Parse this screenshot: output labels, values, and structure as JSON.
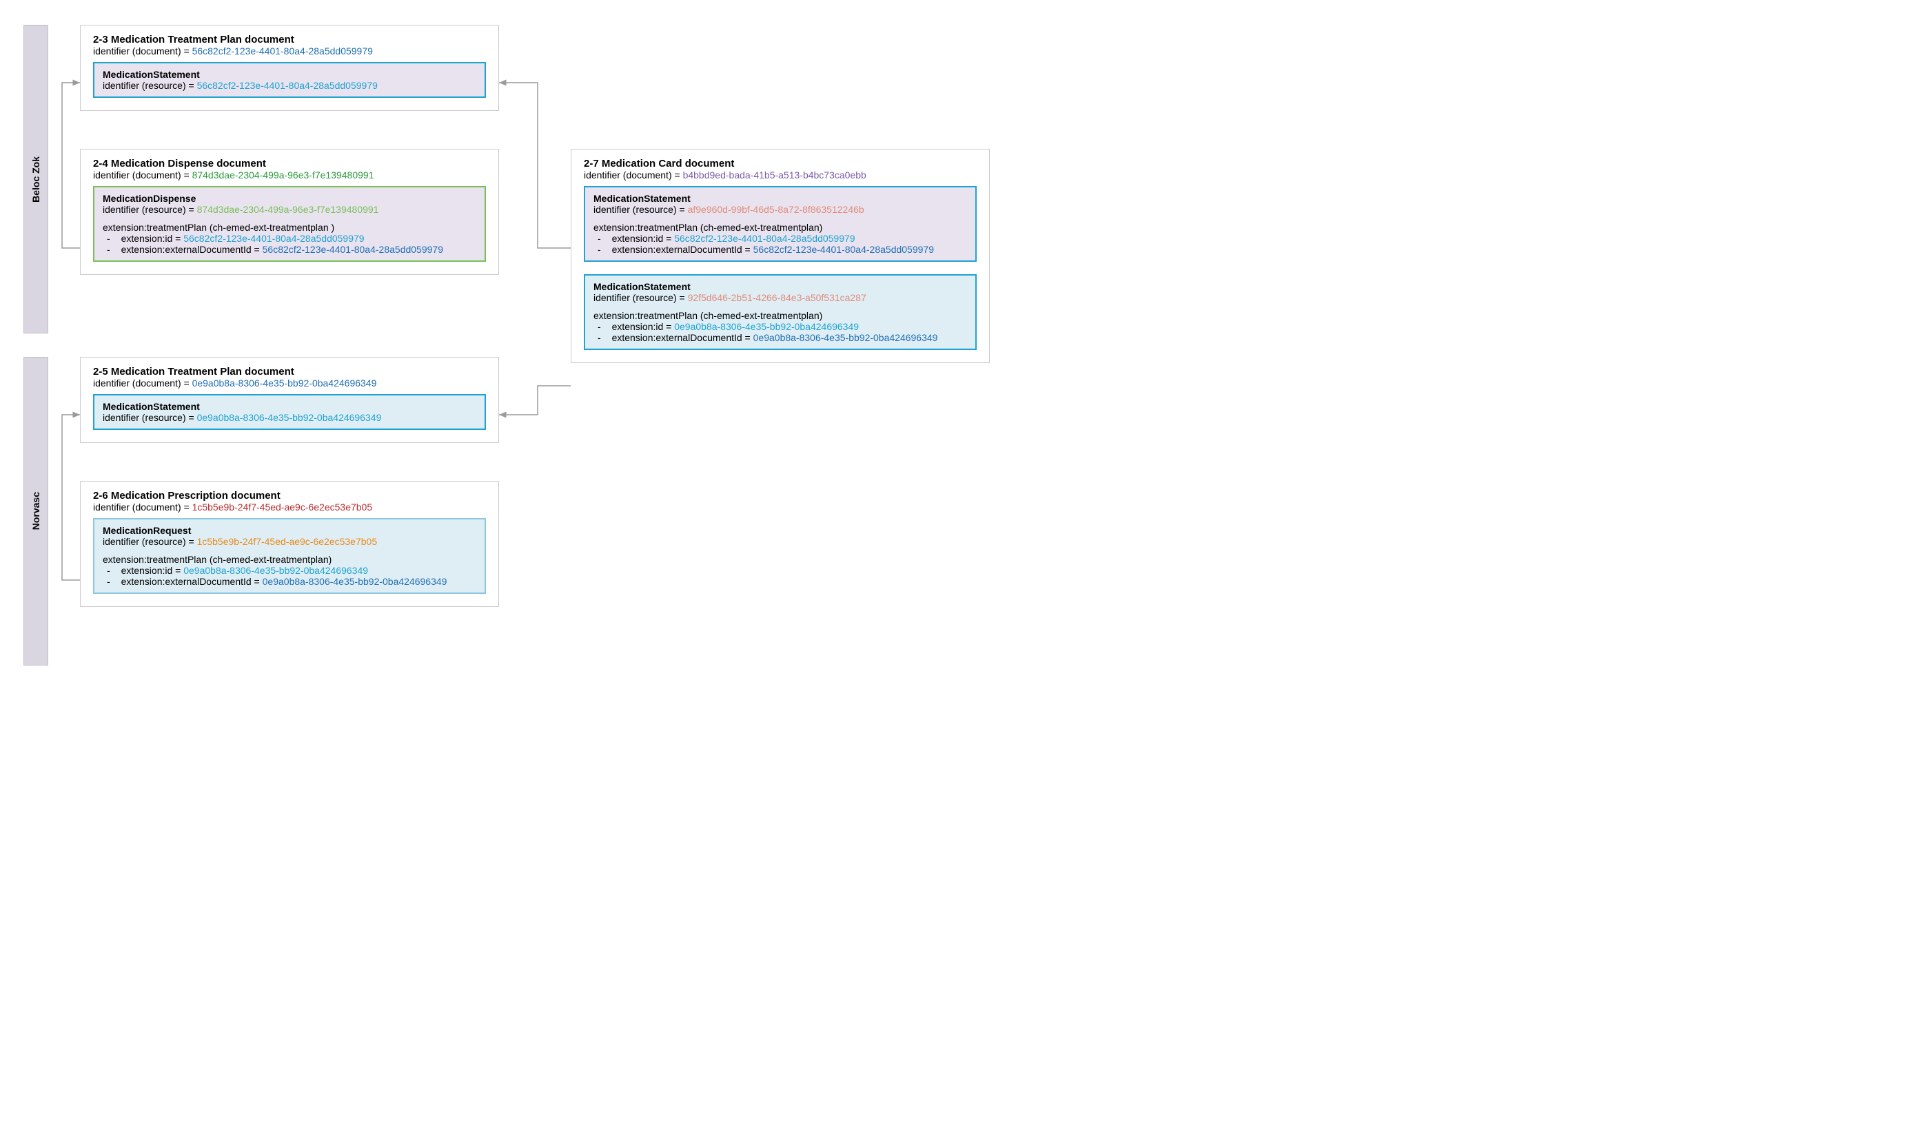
{
  "labels": {
    "beloc": "Beloc Zok",
    "norvasc": "Norvasc"
  },
  "doc23": {
    "title": "2-3 Medication Treatment Plan document",
    "identLabel": "identifier (document) = ",
    "identValue": "56c82cf2-123e-4401-80a4-28a5dd059979",
    "inner": {
      "title": "MedicationStatement",
      "identLabel": "identifier (resource) = ",
      "identValue": "56c82cf2-123e-4401-80a4-28a5dd059979"
    }
  },
  "doc24": {
    "title": "2-4  Medication Dispense document",
    "identLabel": "identifier (document) = ",
    "identValue": "874d3dae-2304-499a-96e3-f7e139480991",
    "inner": {
      "title": "MedicationDispense",
      "identLabel": "identifier (resource) = ",
      "identValue": "874d3dae-2304-499a-96e3-f7e139480991",
      "extLine": "extension:treatmentPlan (ch-emed-ext-treatmentplan )",
      "extIdLabel": "extension:id = ",
      "extIdValue": "56c82cf2-123e-4401-80a4-28a5dd059979",
      "extDocLabel": "extension:externalDocumentId = ",
      "extDocValue": "56c82cf2-123e-4401-80a4-28a5dd059979"
    }
  },
  "doc25": {
    "title": "2-5 Medication Treatment Plan document",
    "identLabel": "identifier (document) = ",
    "identValue": "0e9a0b8a-8306-4e35-bb92-0ba424696349",
    "inner": {
      "title": "MedicationStatement",
      "identLabel": "identifier (resource) = ",
      "identValue": "0e9a0b8a-8306-4e35-bb92-0ba424696349"
    }
  },
  "doc26": {
    "title": "2-6 Medication Prescription document",
    "identLabel": "identifier (document) = ",
    "identValue": "1c5b5e9b-24f7-45ed-ae9c-6e2ec53e7b05",
    "inner": {
      "title": "MedicationRequest",
      "identLabel": "identifier (resource) = ",
      "identValue": "1c5b5e9b-24f7-45ed-ae9c-6e2ec53e7b05",
      "extLine": "extension:treatmentPlan (ch-emed-ext-treatmentplan)",
      "extIdLabel": "extension:id = ",
      "extIdValue": "0e9a0b8a-8306-4e35-bb92-0ba424696349",
      "extDocLabel": "extension:externalDocumentId = ",
      "extDocValue": "0e9a0b8a-8306-4e35-bb92-0ba424696349"
    }
  },
  "doc27": {
    "title": "2-7 Medication Card document",
    "identLabel": "identifier (document) = ",
    "identValue": "b4bbd9ed-bada-41b5-a513-b4bc73ca0ebb",
    "inner1": {
      "title": "MedicationStatement",
      "identLabel": "identifier (resource) = ",
      "identValue": "af9e960d-99bf-46d5-8a72-8f863512246b",
      "extLine": "extension:treatmentPlan (ch-emed-ext-treatmentplan)",
      "extIdLabel": "extension:id = ",
      "extIdValue": "56c82cf2-123e-4401-80a4-28a5dd059979",
      "extDocLabel": "extension:externalDocumentId = ",
      "extDocValue": "56c82cf2-123e-4401-80a4-28a5dd059979"
    },
    "inner2": {
      "title": "MedicationStatement",
      "identLabel": "identifier (resource) = ",
      "identValue": "92f5d646-2b51-4266-84e3-a50f531ca287",
      "extLine": "extension:treatmentPlan (ch-emed-ext-treatmentplan)",
      "extIdLabel": "extension:id = ",
      "extIdValue": "0e9a0b8a-8306-4e35-bb92-0ba424696349",
      "extDocLabel": "extension:externalDocumentId = ",
      "extDocValue": "0e9a0b8a-8306-4e35-bb92-0ba424696349"
    }
  },
  "colors": {
    "darkblue": "#1f6fb3",
    "lightblue": "#1fa3d1",
    "green": "#2e9b3f",
    "lightgreen": "#7bbf5a",
    "darkred": "#b82e2e",
    "orange": "#e8891a",
    "purple": "#7b5aa6",
    "salmon": "#e28b7a",
    "borderBlue": "#1fa3d1",
    "borderGreen": "#7bbf5a",
    "borderLightBlue": "#8bc9e0",
    "bgLilac": "#e8e3ef",
    "bgBlue": "#dfeef5"
  }
}
